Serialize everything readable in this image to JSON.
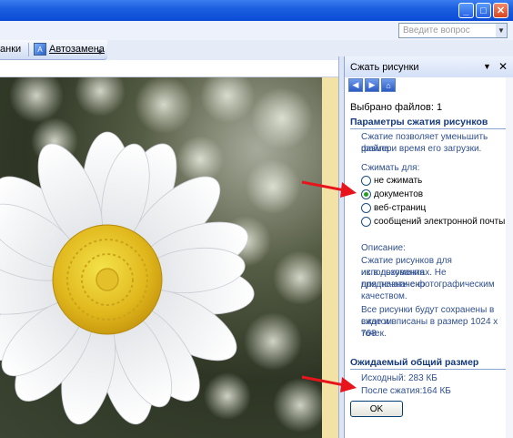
{
  "window": {
    "min_label": "_",
    "max_label": "□",
    "close_label": "✕"
  },
  "ask": {
    "placeholder": "Введите вопрос"
  },
  "toolbar": {
    "left_text": "анки",
    "autocorrect_label": "Автозамена"
  },
  "pane": {
    "title": "Сжать рисунки",
    "selected_files": "Выбрано файлов: 1",
    "compression_heading": "Параметры сжатия рисунков",
    "compression_desc_1": "Сжатие позволяет уменьшить размер",
    "compression_desc_2": "файла и время его загрузки.",
    "compress_for_label": "Сжимать для:",
    "options": [
      "не сжимать",
      "документов",
      "веб-страниц",
      "сообщений электронной почты"
    ],
    "selected_option_index": 1,
    "description_label": "Описание:",
    "description_lines": [
      "Сжатие рисунков для использования",
      "их в документах. Не предназначено",
      "для печати с фотографическим",
      "качеством."
    ],
    "description_lines_2": [
      "Все рисунки будут сохранены в сжатом",
      "виде и вписаны в размер 1024 x 768",
      "точек."
    ],
    "expected_heading": "Ожидаемый общий размер",
    "original_label": "Исходный:",
    "original_value": "283 КБ",
    "after_label": "После сжатия:",
    "after_value": "164 КБ",
    "ok_label": "OK"
  },
  "colors": {
    "arrow": "#e8141c",
    "heading": "#14387a",
    "titlebar": "#0a4bd6"
  },
  "icons": [
    "back-icon",
    "forward-icon",
    "home-icon",
    "autocorrect-icon",
    "dropdown-icon",
    "close-icon"
  ]
}
